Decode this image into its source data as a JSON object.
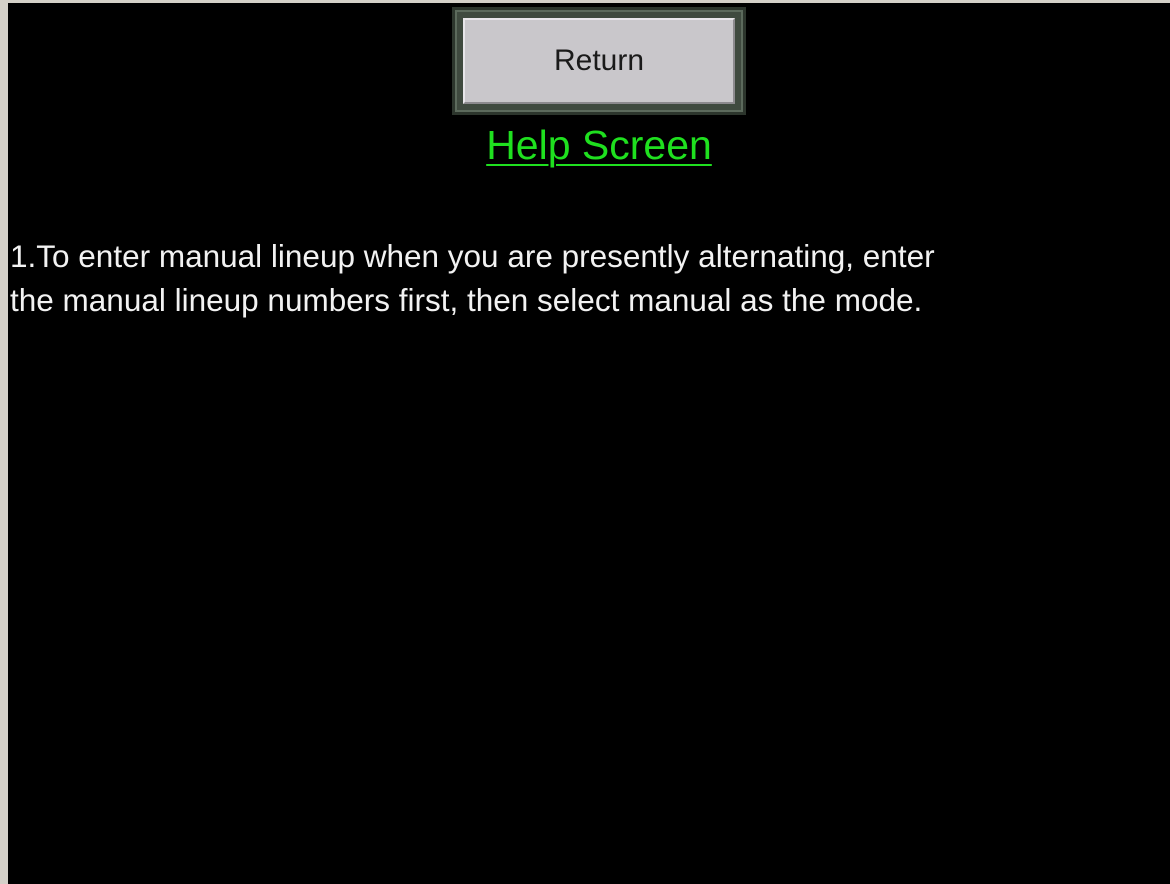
{
  "toolbar": {
    "return_label": "Return"
  },
  "header": {
    "title": "Help Screen"
  },
  "help": {
    "lines": [
      "1.To enter manual lineup when you are presently alternating, enter",
      "the manual lineup numbers first, then select manual as the mode."
    ]
  },
  "colors": {
    "background": "#000000",
    "title": "#1fe01f",
    "text": "#f2f2f2",
    "button_face": "#c9c7cb",
    "button_frame": "#3f4a3f"
  }
}
